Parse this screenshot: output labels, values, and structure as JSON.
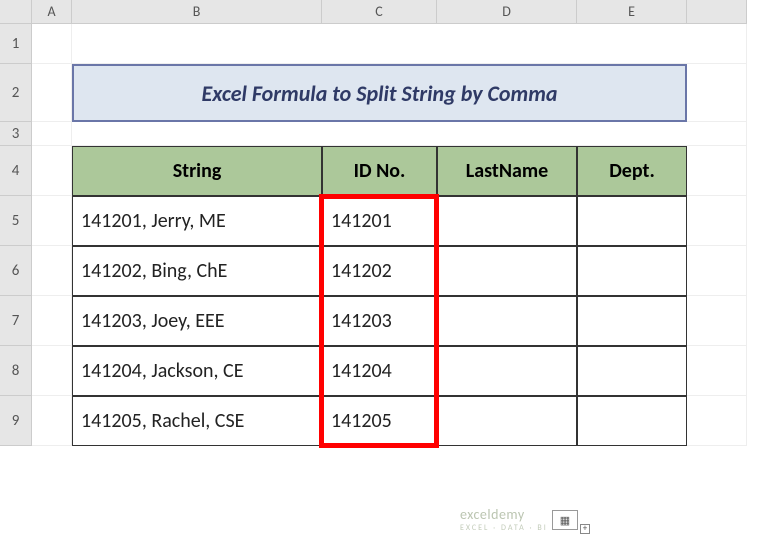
{
  "columns": [
    "A",
    "B",
    "C",
    "D",
    "E"
  ],
  "rows": [
    "1",
    "2",
    "3",
    "4",
    "5",
    "6",
    "7",
    "8",
    "9"
  ],
  "title": "Excel Formula to Split String by Comma",
  "headers": {
    "string": "String",
    "id": "ID No.",
    "lastname": "LastName",
    "dept": "Dept."
  },
  "data": [
    {
      "string": "141201, Jerry, ME",
      "id": "141201",
      "lastname": "",
      "dept": ""
    },
    {
      "string": "141202, Bing, ChE",
      "id": "141202",
      "lastname": "",
      "dept": ""
    },
    {
      "string": "141203, Joey, EEE",
      "id": "141203",
      "lastname": "",
      "dept": ""
    },
    {
      "string": "141204, Jackson, CE",
      "id": "141204",
      "lastname": "",
      "dept": ""
    },
    {
      "string": "141205, Rachel, CSE",
      "id": "141205",
      "lastname": "",
      "dept": ""
    }
  ],
  "watermark": {
    "main": "exceldemy",
    "sub": "EXCEL · DATA · BI"
  },
  "fill_icon": "▦"
}
